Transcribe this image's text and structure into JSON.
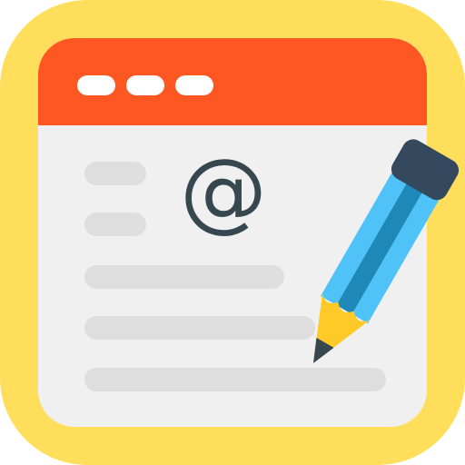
{
  "icon": {
    "symbol": "@",
    "pictogram": "pencil-icon"
  },
  "colors": {
    "frame": "#FFDE5C",
    "window_body": "#F0F0F0",
    "titlebar": "#FF5722",
    "titlebar_dots": "#FFFFFF",
    "text_lines": "#DEDEDE",
    "at_symbol": "#37474F",
    "pencil_body_light": "#4FC3F7",
    "pencil_body_dark": "#1E88B8",
    "pencil_eraser": "#34495E",
    "pencil_wood": "#FFCA28",
    "pencil_lead": "#37474F"
  }
}
